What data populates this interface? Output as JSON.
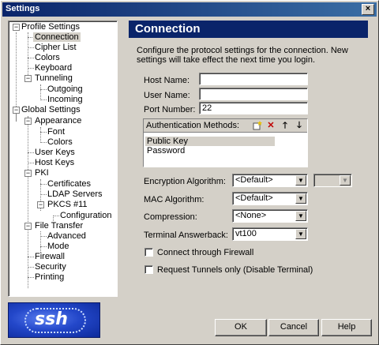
{
  "window": {
    "title": "Settings",
    "close_glyph": "×"
  },
  "tree": {
    "items": [
      {
        "label": "Profile Settings",
        "expander": "−"
      },
      {
        "label": "Connection"
      },
      {
        "label": "Cipher List"
      },
      {
        "label": "Colors"
      },
      {
        "label": "Keyboard"
      },
      {
        "label": "Tunneling",
        "expander": "−"
      },
      {
        "label": "Outgoing"
      },
      {
        "label": "Incoming"
      },
      {
        "label": "Global Settings",
        "expander": "−"
      },
      {
        "label": "Appearance",
        "expander": "−"
      },
      {
        "label": "Font"
      },
      {
        "label": "Colors"
      },
      {
        "label": "User Keys"
      },
      {
        "label": "Host Keys"
      },
      {
        "label": "PKI",
        "expander": "−"
      },
      {
        "label": "Certificates"
      },
      {
        "label": "LDAP Servers"
      },
      {
        "label": "PKCS #11",
        "expander": "−"
      },
      {
        "label": "Configuration"
      },
      {
        "label": "File Transfer",
        "expander": "−"
      },
      {
        "label": "Advanced"
      },
      {
        "label": "Mode"
      },
      {
        "label": "Firewall"
      },
      {
        "label": "Security"
      },
      {
        "label": "Printing"
      }
    ]
  },
  "logo": {
    "text": "ssh"
  },
  "panel": {
    "title": "Connection",
    "description": "Configure the protocol settings for the connection. New settings will take effect the next time you login.",
    "host_name_label": "Host Name:",
    "host_name_value": "",
    "user_name_label": "User Name:",
    "user_name_value": "",
    "port_label": "Port Number:",
    "port_value": "22",
    "auth": {
      "header": "Authentication Methods:",
      "methods": [
        "Public Key",
        "Password"
      ],
      "icons": {
        "new": "new-item-icon",
        "delete": "delete-icon",
        "up": "arrow-up-icon",
        "down": "arrow-down-icon"
      }
    },
    "encryption_label": "Encryption Algorithm:",
    "encryption_value": "<Default>",
    "encryption_secondary_value": "",
    "mac_label": "MAC Algorithm:",
    "mac_value": "<Default>",
    "compression_label": "Compression:",
    "compression_value": "<None>",
    "answerback_label": "Terminal Answerback:",
    "answerback_value": "vt100",
    "firewall_checkbox": "Connect through Firewall",
    "tunnels_checkbox": "Request Tunnels only (Disable Terminal)"
  },
  "buttons": {
    "ok": "OK",
    "cancel": "Cancel",
    "help": "Help"
  },
  "colors": {
    "header_bg": "#0a246a",
    "window_bg": "#d4d0c8",
    "selection_bg": "#d4d0c8"
  }
}
